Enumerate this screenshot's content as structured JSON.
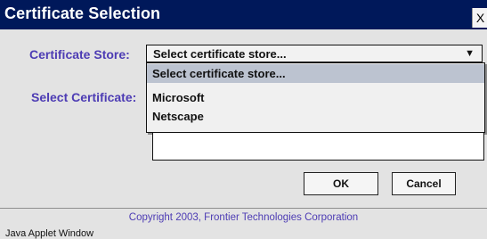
{
  "window": {
    "title": "Certificate Selection",
    "close_label": "X"
  },
  "form": {
    "store_label": "Certificate Store:",
    "store_selected": "Select certificate store...",
    "cert_label": "Select Certificate:",
    "dropdown_options": [
      "Select certificate store...",
      "Microsoft",
      "Netscape"
    ]
  },
  "buttons": {
    "ok_label": "OK",
    "cancel_label": "Cancel"
  },
  "footer": {
    "copyright": "Copyright 2003, Frontier Technologies Corporation",
    "status": "Java Applet Window"
  },
  "colors": {
    "titlebar": "#00185a",
    "label": "#4d3cb4",
    "selected_option": "#bcc3d0"
  },
  "icons": {
    "close": "close-icon",
    "dropdown": "triangle-down-icon"
  }
}
